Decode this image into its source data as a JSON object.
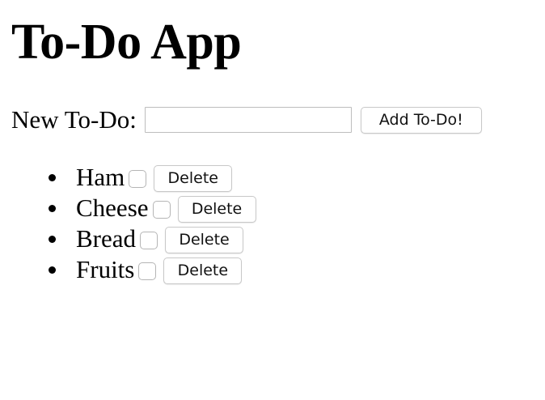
{
  "app": {
    "title": "To-Do App"
  },
  "new_todo": {
    "label": "New To-Do:",
    "value": "",
    "placeholder": "",
    "add_label": "Add To-Do!"
  },
  "todos": [
    {
      "text": "Ham",
      "checked": false,
      "delete_label": "Delete"
    },
    {
      "text": "Cheese",
      "checked": false,
      "delete_label": "Delete"
    },
    {
      "text": "Bread",
      "checked": false,
      "delete_label": "Delete"
    },
    {
      "text": "Fruits",
      "checked": false,
      "delete_label": "Delete"
    }
  ]
}
